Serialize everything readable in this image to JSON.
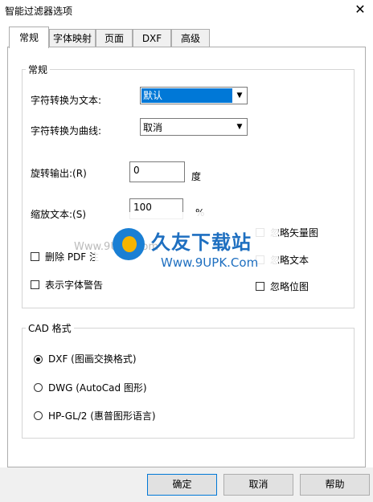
{
  "window": {
    "title": "智能过滤器选项",
    "close_label": "✕"
  },
  "tabs": [
    {
      "label": "常规"
    },
    {
      "label": "字体映射"
    },
    {
      "label": "页面"
    },
    {
      "label": "DXF"
    },
    {
      "label": "高级"
    }
  ],
  "general": {
    "group_label": "常规",
    "char_to_text": {
      "label": "字符转换为文本:",
      "value": "默认"
    },
    "char_to_curve": {
      "label": "字符转换为曲线:",
      "value": "取消"
    },
    "rotate": {
      "label": "旋转输出:(R)",
      "value": "0",
      "unit": "度"
    },
    "scale": {
      "label": "缩放文本:(S)",
      "value": "100",
      "unit": "%"
    },
    "delete_pdf": {
      "label": "删除 PDF 注"
    },
    "show_font_warning": {
      "label": "表示字体警告"
    },
    "ignore_vector": {
      "label": "忽略矢量图"
    },
    "ignore_text": {
      "label": "忽略文本"
    },
    "ignore_bitmap": {
      "label": "忽略位图"
    }
  },
  "cad": {
    "group_label": "CAD 格式",
    "options": [
      {
        "label": "DXF (图画交换格式)",
        "selected": true
      },
      {
        "label": "DWG (AutoCad 图形)",
        "selected": false
      },
      {
        "label": "HP-GL/2 (惠普图形语言)",
        "selected": false
      }
    ]
  },
  "buttons": {
    "ok": "确定",
    "cancel": "取消",
    "help": "帮助"
  },
  "watermark": {
    "brand": "久友下载站",
    "url": "Www.9UPK.Com",
    "faint": "Www.9UPK.Com"
  }
}
